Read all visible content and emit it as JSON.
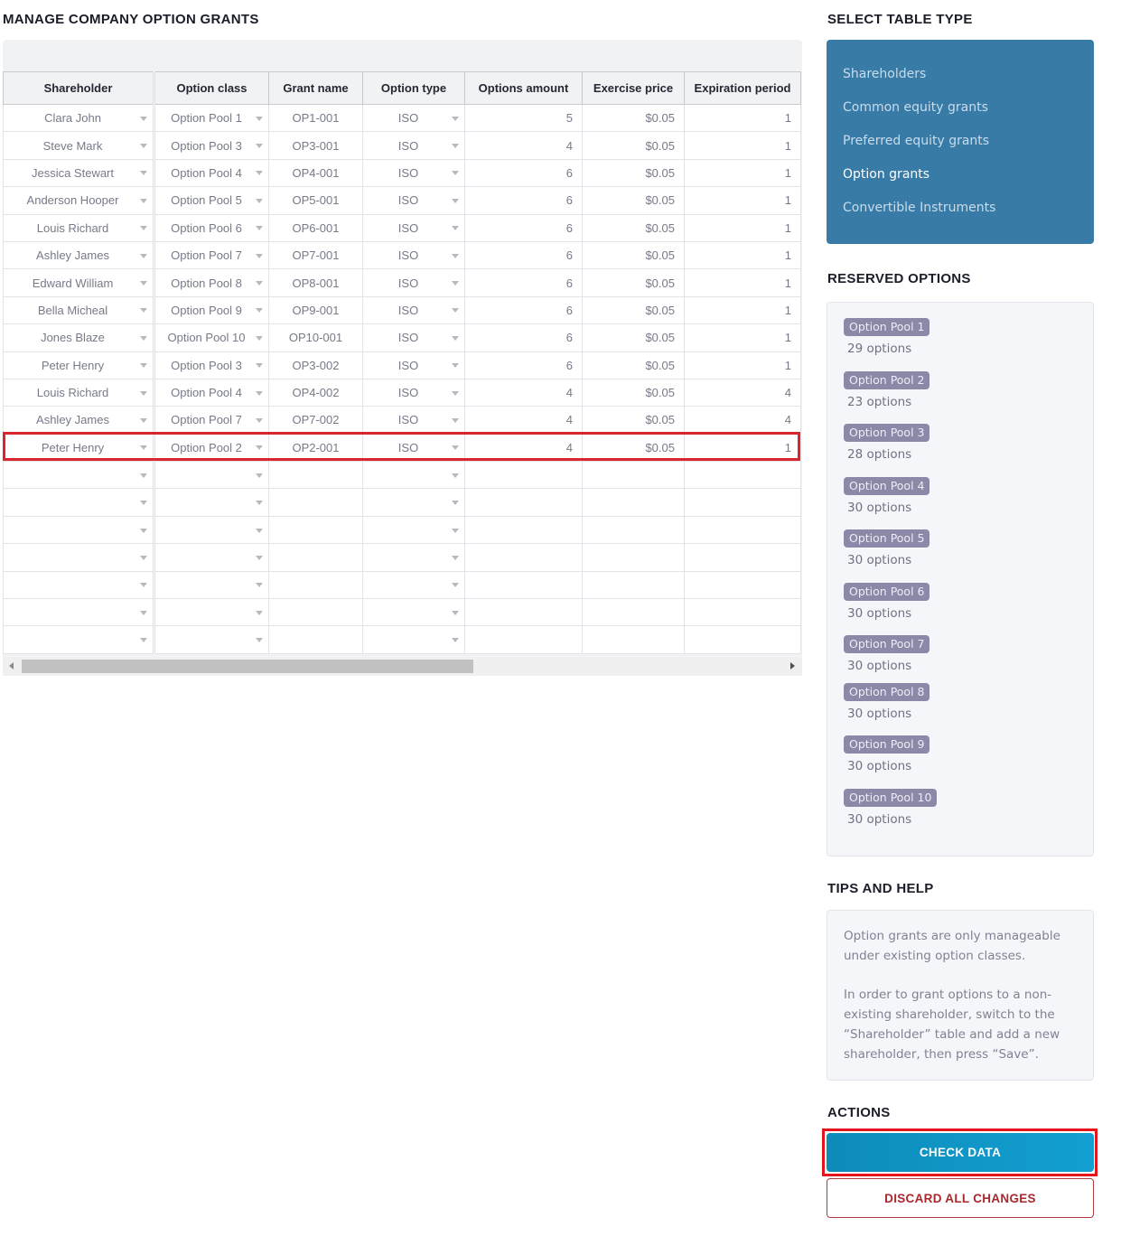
{
  "main": {
    "title": "MANAGE COMPANY OPTION GRANTS",
    "columns": [
      "Shareholder",
      "Option class",
      "Grant name",
      "Option type",
      "Options amount",
      "Exercise price",
      "Expiration period"
    ],
    "rows": [
      {
        "shareholder": "Clara John",
        "option_class": "Option Pool 1",
        "grant_name": "OP1-001",
        "option_type": "ISO",
        "options_amount": "5",
        "exercise_price": "$0.05",
        "expiration_period": "1"
      },
      {
        "shareholder": "Steve Mark",
        "option_class": "Option Pool 3",
        "grant_name": "OP3-001",
        "option_type": "ISO",
        "options_amount": "4",
        "exercise_price": "$0.05",
        "expiration_period": "1"
      },
      {
        "shareholder": "Jessica Stewart",
        "option_class": "Option Pool 4",
        "grant_name": "OP4-001",
        "option_type": "ISO",
        "options_amount": "6",
        "exercise_price": "$0.05",
        "expiration_period": "1"
      },
      {
        "shareholder": "Anderson Hooper",
        "option_class": "Option Pool 5",
        "grant_name": "OP5-001",
        "option_type": "ISO",
        "options_amount": "6",
        "exercise_price": "$0.05",
        "expiration_period": "1"
      },
      {
        "shareholder": "Louis Richard",
        "option_class": "Option Pool 6",
        "grant_name": "OP6-001",
        "option_type": "ISO",
        "options_amount": "6",
        "exercise_price": "$0.05",
        "expiration_period": "1"
      },
      {
        "shareholder": "Ashley James",
        "option_class": "Option Pool 7",
        "grant_name": "OP7-001",
        "option_type": "ISO",
        "options_amount": "6",
        "exercise_price": "$0.05",
        "expiration_period": "1"
      },
      {
        "shareholder": "Edward William",
        "option_class": "Option Pool 8",
        "grant_name": "OP8-001",
        "option_type": "ISO",
        "options_amount": "6",
        "exercise_price": "$0.05",
        "expiration_period": "1"
      },
      {
        "shareholder": "Bella Micheal",
        "option_class": "Option Pool 9",
        "grant_name": "OP9-001",
        "option_type": "ISO",
        "options_amount": "6",
        "exercise_price": "$0.05",
        "expiration_period": "1"
      },
      {
        "shareholder": "Jones Blaze",
        "option_class": "Option Pool 10",
        "grant_name": "OP10-001",
        "option_type": "ISO",
        "options_amount": "6",
        "exercise_price": "$0.05",
        "expiration_period": "1"
      },
      {
        "shareholder": "Peter Henry",
        "option_class": "Option Pool 3",
        "grant_name": "OP3-002",
        "option_type": "ISO",
        "options_amount": "6",
        "exercise_price": "$0.05",
        "expiration_period": "1"
      },
      {
        "shareholder": "Louis Richard",
        "option_class": "Option Pool 4",
        "grant_name": "OP4-002",
        "option_type": "ISO",
        "options_amount": "4",
        "exercise_price": "$0.05",
        "expiration_period": "4"
      },
      {
        "shareholder": "Ashley James",
        "option_class": "Option Pool 7",
        "grant_name": "OP7-002",
        "option_type": "ISO",
        "options_amount": "4",
        "exercise_price": "$0.05",
        "expiration_period": "4"
      },
      {
        "shareholder": "Peter Henry",
        "option_class": "Option Pool 2",
        "grant_name": "OP2-001",
        "option_type": "ISO",
        "options_amount": "4",
        "exercise_price": "$0.05",
        "expiration_period": "1"
      }
    ],
    "empty_row_count": 7,
    "highlighted_row_index": 12
  },
  "sidebar": {
    "table_type": {
      "title": "SELECT TABLE TYPE",
      "items": [
        {
          "label": "Shareholders",
          "active": false
        },
        {
          "label": "Common equity grants",
          "active": false
        },
        {
          "label": "Preferred equity grants",
          "active": false
        },
        {
          "label": "Option grants",
          "active": true
        },
        {
          "label": "Convertible Instruments",
          "active": false
        }
      ]
    },
    "reserved": {
      "title": "RESERVED OPTIONS",
      "pools": [
        {
          "name": "Option Pool 1",
          "count": "29 options"
        },
        {
          "name": "Option Pool 2",
          "count": "23 options"
        },
        {
          "name": "Option Pool 3",
          "count": "28 options"
        },
        {
          "name": "Option Pool 4",
          "count": "30 options"
        },
        {
          "name": "Option Pool 5",
          "count": "30 options"
        },
        {
          "name": "Option Pool 6",
          "count": "30 options"
        },
        {
          "name": "Option Pool 7",
          "count": "30 options"
        },
        {
          "name": "Option Pool 8",
          "count": "30 options"
        },
        {
          "name": "Option Pool 9",
          "count": "30 options"
        },
        {
          "name": "Option Pool 10",
          "count": "30 options"
        }
      ]
    },
    "tips": {
      "title": "TIPS AND HELP",
      "paragraphs": [
        "Option grants are only manageable under existing option classes.",
        "In order to grant options to a non-existing shareholder, switch to the “Shareholder” table and add a new shareholder, then press “Save”."
      ]
    },
    "actions": {
      "title": "ACTIONS",
      "check_label": "CHECK DATA",
      "discard_label": "DISCARD ALL CHANGES"
    }
  },
  "colors": {
    "panel_blue": "#377ba6",
    "check_button": "#139fd2",
    "discard_text": "#a8282e",
    "highlight_red": "#d9262e",
    "pool_badge": "#8b88a8"
  }
}
